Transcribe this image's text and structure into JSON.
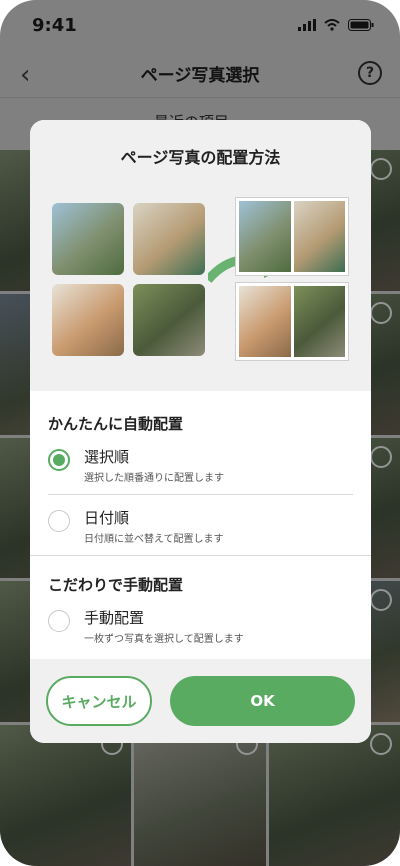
{
  "status_bar": {
    "time": "9:41"
  },
  "nav": {
    "title": "ページ写真選択",
    "subtitle": "最近の項目"
  },
  "modal": {
    "title": "ページ写真の配置方法",
    "auto_section": "かんたんに自動配置",
    "manual_section": "こだわりで手動配置",
    "options": [
      {
        "title": "選択順",
        "subtitle": "選択した順番通りに配置します",
        "selected": true
      },
      {
        "title": "日付順",
        "subtitle": "日付順に並べ替えて配置します",
        "selected": false
      },
      {
        "title": "手動配置",
        "subtitle": "一枚ずつ写真を選択して配置します",
        "selected": false
      }
    ],
    "cancel_label": "キャンセル",
    "ok_label": "OK"
  },
  "colors": {
    "accent": "#5aab62"
  }
}
